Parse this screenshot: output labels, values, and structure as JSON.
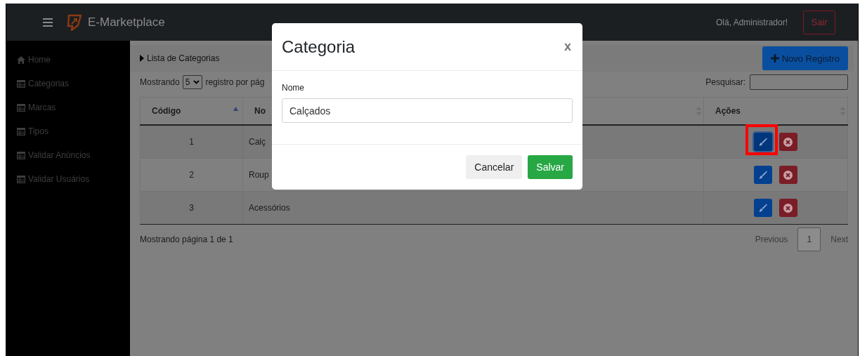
{
  "navbar": {
    "brand": "E-Marketplace",
    "greeting": "Olá, Administrador!",
    "logout": "Sair"
  },
  "sidebar": {
    "items": [
      {
        "label": "Home",
        "kind": "home"
      },
      {
        "label": "Categorias",
        "kind": "table"
      },
      {
        "label": "Marcas",
        "kind": "table"
      },
      {
        "label": "Tipos",
        "kind": "table"
      },
      {
        "label": "Validar Anúncios",
        "kind": "table"
      },
      {
        "label": "Validar Usuários",
        "kind": "table"
      }
    ]
  },
  "content": {
    "breadcrumb": "Lista de Categorias",
    "new_button": "Novo Registro",
    "length": {
      "prefix": "Mostrando",
      "value": "5",
      "suffix": "registro por pág"
    },
    "search_label": "Pesquisar:",
    "table": {
      "columns": [
        {
          "label": "Código",
          "sorted": true
        },
        {
          "label": "No",
          "sorted": false
        },
        {
          "label": "Ações",
          "sorted": false
        }
      ],
      "rows": [
        {
          "code": "1",
          "name": "Calç",
          "annotated": true
        },
        {
          "code": "2",
          "name": "Roup",
          "annotated": false
        },
        {
          "code": "3",
          "name": "Acessórios",
          "annotated": false
        }
      ]
    },
    "info": "Mostrando página 1 de 1",
    "pagination": {
      "previous": "Previous",
      "pages": [
        {
          "label": "1",
          "selected": true
        }
      ],
      "next": "Next"
    }
  },
  "modal": {
    "title": "Categoria",
    "close": "x",
    "field_label": "Nome",
    "field_value": "Calçados",
    "buttons": [
      {
        "label": "Cancelar",
        "kind": "secondary"
      },
      {
        "label": "Salvar",
        "kind": "primary"
      }
    ]
  }
}
